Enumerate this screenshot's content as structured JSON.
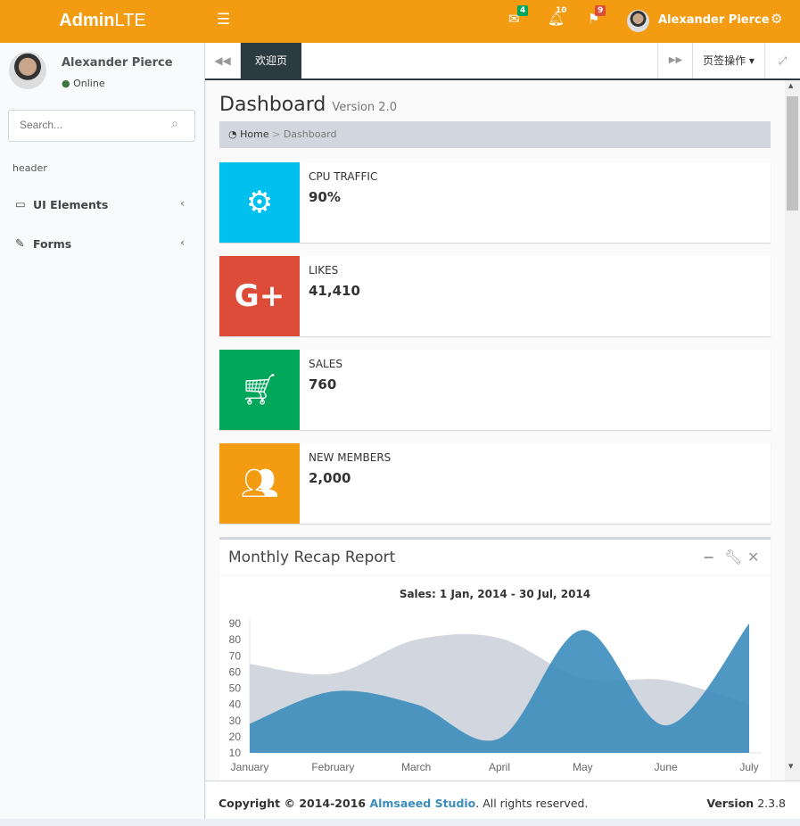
{
  "header": {
    "logo_bold": "Admin",
    "logo_light": "LTE",
    "messages_count": "4",
    "notifications_count": "10",
    "tasks_count": "9",
    "user_name": "Alexander Pierce"
  },
  "sidebar": {
    "user_name": "Alexander Pierce",
    "status": "Online",
    "search_placeholder": "Search...",
    "section_header": "header",
    "items": [
      {
        "label": "UI Elements",
        "icon": "laptop-icon"
      },
      {
        "label": "Forms",
        "icon": "edit-icon"
      }
    ]
  },
  "tabs": {
    "active": "欢迎页",
    "tab_ops": "页签操作"
  },
  "page": {
    "title": "Dashboard",
    "subtitle": "Version 2.0",
    "breadcrumb": [
      "Home",
      "Dashboard"
    ]
  },
  "info_boxes": [
    {
      "label": "CPU TRAFFIC",
      "value": "90%",
      "color": "#00c0ef",
      "icon": "gear-icon"
    },
    {
      "label": "LIKES",
      "value": "41,410",
      "color": "#dd4b39",
      "icon": "google-plus-icon"
    },
    {
      "label": "SALES",
      "value": "760",
      "color": "#00a65a",
      "icon": "shopping-cart-icon"
    },
    {
      "label": "NEW MEMBERS",
      "value": "2,000",
      "color": "#f39c12",
      "icon": "users-icon"
    }
  ],
  "report": {
    "title": "Monthly Recap Report"
  },
  "chart_data": {
    "type": "area",
    "title": "Sales: 1 Jan, 2014 - 30 Jul, 2014",
    "categories": [
      "January",
      "February",
      "March",
      "April",
      "May",
      "June",
      "July"
    ],
    "ylim": [
      10,
      90
    ],
    "yticks": [
      10,
      20,
      30,
      40,
      50,
      60,
      70,
      80,
      90
    ],
    "series": [
      {
        "values": [
          65,
          59,
          80,
          81,
          56,
          55,
          40
        ],
        "color": "#d2d6de"
      },
      {
        "values": [
          28,
          48,
          40,
          19,
          86,
          27,
          90
        ],
        "color": "#3c8dbc"
      }
    ]
  },
  "footer": {
    "copyright": "Copyright © 2014-2016 ",
    "company": "Almsaeed Studio",
    "rights": ". All rights reserved.",
    "version_label": "Version",
    "version": "2.3.8"
  }
}
